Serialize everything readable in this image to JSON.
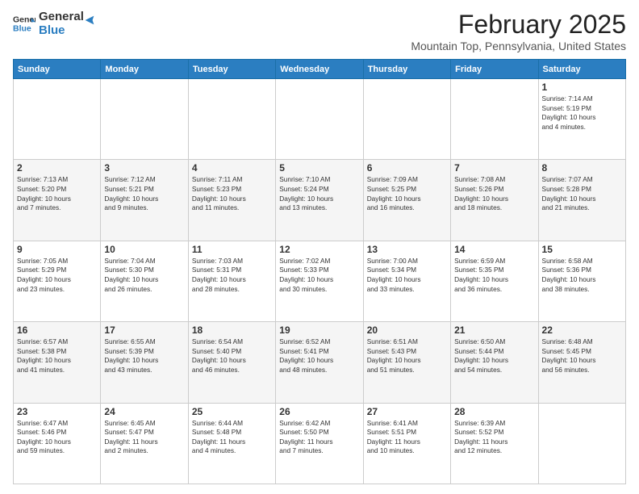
{
  "header": {
    "logo": {
      "line1": "General",
      "line2": "Blue"
    },
    "title": "February 2025",
    "location": "Mountain Top, Pennsylvania, United States"
  },
  "weekdays": [
    "Sunday",
    "Monday",
    "Tuesday",
    "Wednesday",
    "Thursday",
    "Friday",
    "Saturday"
  ],
  "weeks": [
    [
      {
        "day": "",
        "info": ""
      },
      {
        "day": "",
        "info": ""
      },
      {
        "day": "",
        "info": ""
      },
      {
        "day": "",
        "info": ""
      },
      {
        "day": "",
        "info": ""
      },
      {
        "day": "",
        "info": ""
      },
      {
        "day": "1",
        "info": "Sunrise: 7:14 AM\nSunset: 5:19 PM\nDaylight: 10 hours\nand 4 minutes."
      }
    ],
    [
      {
        "day": "2",
        "info": "Sunrise: 7:13 AM\nSunset: 5:20 PM\nDaylight: 10 hours\nand 7 minutes."
      },
      {
        "day": "3",
        "info": "Sunrise: 7:12 AM\nSunset: 5:21 PM\nDaylight: 10 hours\nand 9 minutes."
      },
      {
        "day": "4",
        "info": "Sunrise: 7:11 AM\nSunset: 5:23 PM\nDaylight: 10 hours\nand 11 minutes."
      },
      {
        "day": "5",
        "info": "Sunrise: 7:10 AM\nSunset: 5:24 PM\nDaylight: 10 hours\nand 13 minutes."
      },
      {
        "day": "6",
        "info": "Sunrise: 7:09 AM\nSunset: 5:25 PM\nDaylight: 10 hours\nand 16 minutes."
      },
      {
        "day": "7",
        "info": "Sunrise: 7:08 AM\nSunset: 5:26 PM\nDaylight: 10 hours\nand 18 minutes."
      },
      {
        "day": "8",
        "info": "Sunrise: 7:07 AM\nSunset: 5:28 PM\nDaylight: 10 hours\nand 21 minutes."
      }
    ],
    [
      {
        "day": "9",
        "info": "Sunrise: 7:05 AM\nSunset: 5:29 PM\nDaylight: 10 hours\nand 23 minutes."
      },
      {
        "day": "10",
        "info": "Sunrise: 7:04 AM\nSunset: 5:30 PM\nDaylight: 10 hours\nand 26 minutes."
      },
      {
        "day": "11",
        "info": "Sunrise: 7:03 AM\nSunset: 5:31 PM\nDaylight: 10 hours\nand 28 minutes."
      },
      {
        "day": "12",
        "info": "Sunrise: 7:02 AM\nSunset: 5:33 PM\nDaylight: 10 hours\nand 30 minutes."
      },
      {
        "day": "13",
        "info": "Sunrise: 7:00 AM\nSunset: 5:34 PM\nDaylight: 10 hours\nand 33 minutes."
      },
      {
        "day": "14",
        "info": "Sunrise: 6:59 AM\nSunset: 5:35 PM\nDaylight: 10 hours\nand 36 minutes."
      },
      {
        "day": "15",
        "info": "Sunrise: 6:58 AM\nSunset: 5:36 PM\nDaylight: 10 hours\nand 38 minutes."
      }
    ],
    [
      {
        "day": "16",
        "info": "Sunrise: 6:57 AM\nSunset: 5:38 PM\nDaylight: 10 hours\nand 41 minutes."
      },
      {
        "day": "17",
        "info": "Sunrise: 6:55 AM\nSunset: 5:39 PM\nDaylight: 10 hours\nand 43 minutes."
      },
      {
        "day": "18",
        "info": "Sunrise: 6:54 AM\nSunset: 5:40 PM\nDaylight: 10 hours\nand 46 minutes."
      },
      {
        "day": "19",
        "info": "Sunrise: 6:52 AM\nSunset: 5:41 PM\nDaylight: 10 hours\nand 48 minutes."
      },
      {
        "day": "20",
        "info": "Sunrise: 6:51 AM\nSunset: 5:43 PM\nDaylight: 10 hours\nand 51 minutes."
      },
      {
        "day": "21",
        "info": "Sunrise: 6:50 AM\nSunset: 5:44 PM\nDaylight: 10 hours\nand 54 minutes."
      },
      {
        "day": "22",
        "info": "Sunrise: 6:48 AM\nSunset: 5:45 PM\nDaylight: 10 hours\nand 56 minutes."
      }
    ],
    [
      {
        "day": "23",
        "info": "Sunrise: 6:47 AM\nSunset: 5:46 PM\nDaylight: 10 hours\nand 59 minutes."
      },
      {
        "day": "24",
        "info": "Sunrise: 6:45 AM\nSunset: 5:47 PM\nDaylight: 11 hours\nand 2 minutes."
      },
      {
        "day": "25",
        "info": "Sunrise: 6:44 AM\nSunset: 5:48 PM\nDaylight: 11 hours\nand 4 minutes."
      },
      {
        "day": "26",
        "info": "Sunrise: 6:42 AM\nSunset: 5:50 PM\nDaylight: 11 hours\nand 7 minutes."
      },
      {
        "day": "27",
        "info": "Sunrise: 6:41 AM\nSunset: 5:51 PM\nDaylight: 11 hours\nand 10 minutes."
      },
      {
        "day": "28",
        "info": "Sunrise: 6:39 AM\nSunset: 5:52 PM\nDaylight: 11 hours\nand 12 minutes."
      },
      {
        "day": "",
        "info": ""
      }
    ]
  ]
}
